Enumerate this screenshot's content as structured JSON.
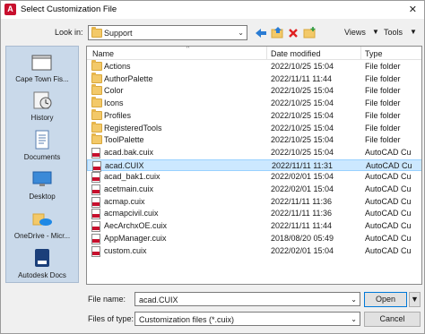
{
  "window": {
    "title": "Select Customization File"
  },
  "toolbar": {
    "look_in_label": "Look in:",
    "look_in_value": "Support",
    "views_label": "Views",
    "tools_label": "Tools",
    "dropdown_arrow": "▼"
  },
  "places": [
    {
      "label": "Cape Town Fis...",
      "icon": "folder-icon"
    },
    {
      "label": "History",
      "icon": "history-icon"
    },
    {
      "label": "Documents",
      "icon": "documents-icon"
    },
    {
      "label": "Desktop",
      "icon": "desktop-icon"
    },
    {
      "label": "OneDrive - Micr...",
      "icon": "onedrive-icon"
    },
    {
      "label": "Autodesk Docs",
      "icon": "autodesk-docs-icon"
    }
  ],
  "filelist": {
    "columns": {
      "name": "Name",
      "date": "Date modified",
      "type": "Type"
    },
    "rows": [
      {
        "name": "Actions",
        "date": "2022/10/25 15:04",
        "type": "File folder",
        "kind": "folder"
      },
      {
        "name": "AuthorPalette",
        "date": "2022/11/11 11:44",
        "type": "File folder",
        "kind": "folder"
      },
      {
        "name": "Color",
        "date": "2022/10/25 15:04",
        "type": "File folder",
        "kind": "folder"
      },
      {
        "name": "Icons",
        "date": "2022/10/25 15:04",
        "type": "File folder",
        "kind": "folder"
      },
      {
        "name": "Profiles",
        "date": "2022/10/25 15:04",
        "type": "File folder",
        "kind": "folder"
      },
      {
        "name": "RegisteredTools",
        "date": "2022/10/25 15:04",
        "type": "File folder",
        "kind": "folder"
      },
      {
        "name": "ToolPalette",
        "date": "2022/10/25 15:04",
        "type": "File folder",
        "kind": "folder"
      },
      {
        "name": "acad.bak.cuix",
        "date": "2022/10/25 15:04",
        "type": "AutoCAD Cu",
        "kind": "cuix"
      },
      {
        "name": "acad.CUIX",
        "date": "2022/11/11 11:31",
        "type": "AutoCAD Cu",
        "kind": "cuix",
        "selected": true
      },
      {
        "name": "acad_bak1.cuix",
        "date": "2022/02/01 15:04",
        "type": "AutoCAD Cu",
        "kind": "cuix"
      },
      {
        "name": "acetmain.cuix",
        "date": "2022/02/01 15:04",
        "type": "AutoCAD Cu",
        "kind": "cuix"
      },
      {
        "name": "acmap.cuix",
        "date": "2022/11/11 11:36",
        "type": "AutoCAD Cu",
        "kind": "cuix"
      },
      {
        "name": "acmapcivil.cuix",
        "date": "2022/11/11 11:36",
        "type": "AutoCAD Cu",
        "kind": "cuix"
      },
      {
        "name": "AecArchxOE.cuix",
        "date": "2022/11/11 11:44",
        "type": "AutoCAD Cu",
        "kind": "cuix"
      },
      {
        "name": "AppManager.cuix",
        "date": "2018/08/20 05:49",
        "type": "AutoCAD Cu",
        "kind": "cuix"
      },
      {
        "name": "custom.cuix",
        "date": "2022/02/01 15:04",
        "type": "AutoCAD Cu",
        "kind": "cuix"
      }
    ]
  },
  "bottom": {
    "file_name_label": "File name:",
    "file_name_value": "acad.CUIX",
    "files_of_type_label": "Files of type:",
    "files_of_type_value": "Customization files (*.cuix)",
    "open_label": "Open",
    "cancel_label": "Cancel"
  },
  "colors": {
    "accent": "#0078d7",
    "selection": "#cce8ff",
    "places_bg": "#c9d9ea",
    "autodesk_red": "#c8102e"
  }
}
